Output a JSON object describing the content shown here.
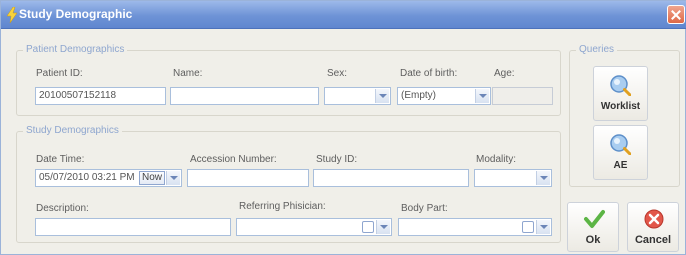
{
  "window": {
    "title": "Study Demographic"
  },
  "patient": {
    "group_label": "Patient Demographics",
    "patient_id_label": "Patient ID:",
    "patient_id_value": "20100507152118",
    "name_label": "Name:",
    "name_value": "",
    "sex_label": "Sex:",
    "sex_value": "",
    "dob_label": "Date of birth:",
    "dob_value": "(Empty)",
    "age_label": "Age:",
    "age_value": ""
  },
  "study": {
    "group_label": "Study Demographics",
    "datetime_label": "Date Time:",
    "datetime_value": "05/07/2010 03:21 PM",
    "now_label": "Now",
    "accession_label": "Accession Number:",
    "accession_value": "",
    "studyid_label": "Study ID:",
    "studyid_value": "",
    "modality_label": "Modality:",
    "modality_value": "",
    "description_label": "Description:",
    "description_value": "",
    "physician_label": "Referring Phisician:",
    "physician_value": "",
    "bodypart_label": "Body Part:",
    "bodypart_value": ""
  },
  "queries": {
    "group_label": "Queries",
    "worklist_label": "Worklist",
    "ae_label": "AE"
  },
  "actions": {
    "ok_label": "Ok",
    "cancel_label": "Cancel"
  },
  "colors": {
    "titlebar": "#6e93d6",
    "group_label": "#8ea6cf",
    "field_border": "#a9bfdc",
    "ok_green": "#5cb545",
    "cancel_red": "#e2574a"
  }
}
